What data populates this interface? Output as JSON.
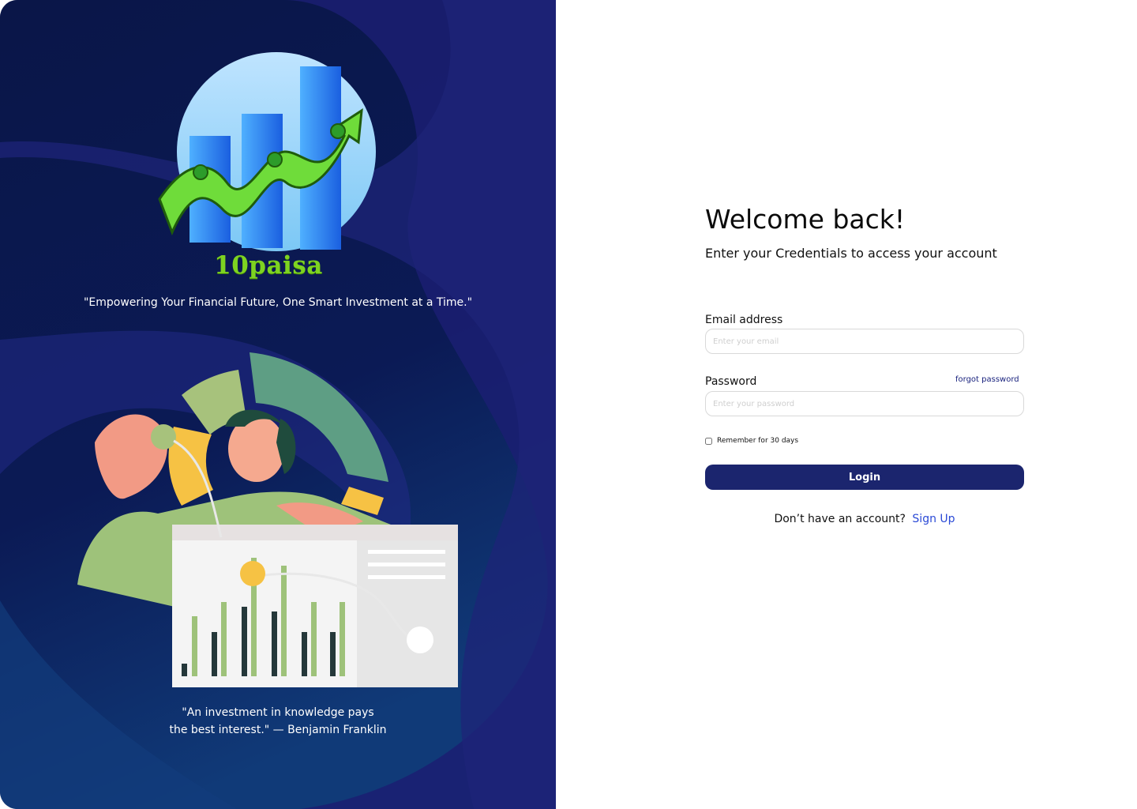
{
  "brand": {
    "name": "10paisa",
    "tagline": "\"Empowering Your Financial Future, One Smart Investment at a Time.\"",
    "quote_line1": "\"An investment in knowledge pays",
    "quote_line2": "the best interest.\" — Benjamin Franklin"
  },
  "login": {
    "title": "Welcome back!",
    "subtitle": "Enter your Credentials to access your account",
    "email_label": "Email address",
    "email_placeholder": "Enter your email",
    "email_value": "",
    "password_label": "Password",
    "password_placeholder": "Enter your password",
    "password_value": "",
    "forgot_label": "forgot password",
    "remember_label": "Remember for 30 days",
    "remember_checked": false,
    "login_label": "Login",
    "signup_prompt": "Don’t have an account?",
    "signup_label": "Sign Up"
  },
  "colors": {
    "panel_bg": "#0b1650",
    "brand_green": "#7ed321",
    "button_bg": "#1b256e",
    "link_blue": "#2a49d6"
  },
  "icons": [
    "growth-chart-logo-icon",
    "money-arrow-icon",
    "person-analytics-illustration"
  ]
}
